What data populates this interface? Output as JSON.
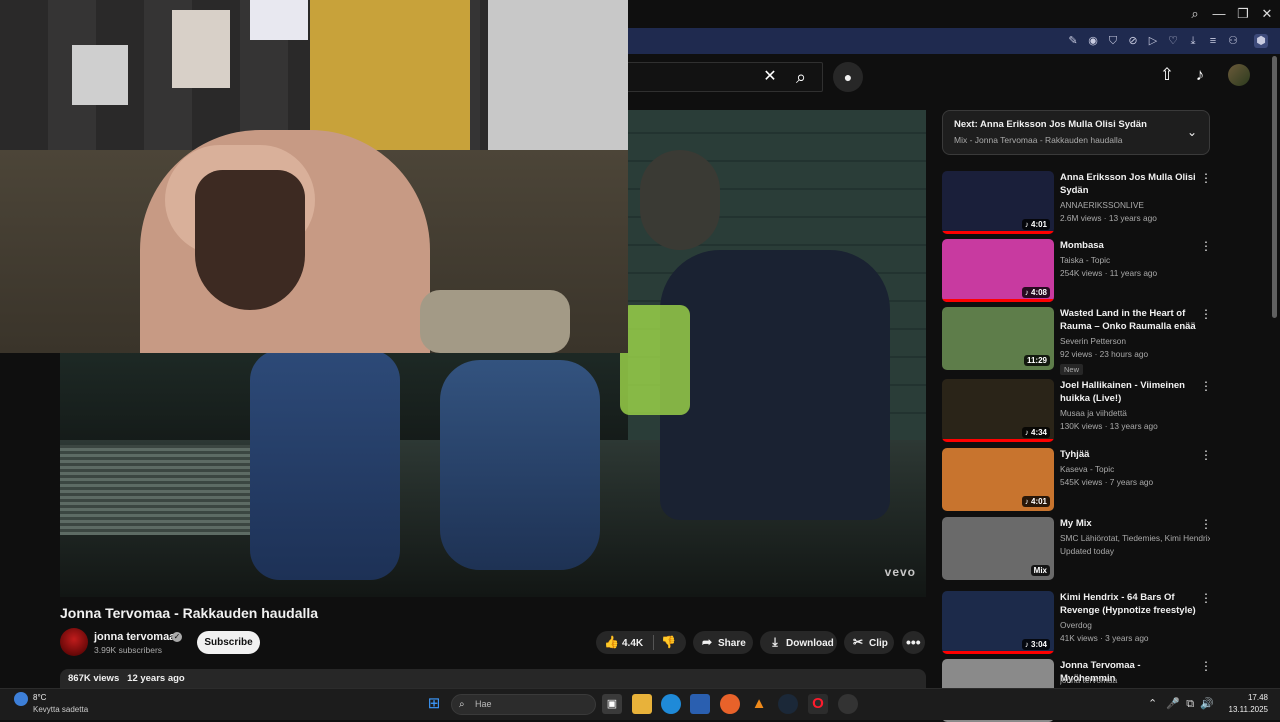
{
  "browser": {
    "window_controls": [
      "search-icon",
      "minimize-icon",
      "restore-icon",
      "close-icon"
    ],
    "extension_icons": [
      "edit-icon",
      "camera-icon",
      "shield-icon",
      "vpn-icon",
      "play-icon",
      "heart-icon",
      "download-icon",
      "menu-icon",
      "profile-icon",
      "extension-icon"
    ]
  },
  "youtube_header": {
    "clear_icon": "✕",
    "search_icon": "⌕",
    "mic_icon": "🎙",
    "upload_icon": "⇧",
    "bell_icon": "🔔"
  },
  "video": {
    "watermark": "vevo",
    "title": "Jonna Tervomaa - Rakkauden haudalla",
    "channel": "jonna tervomaa",
    "subscribers": "3.99K subscribers",
    "subscribe_label": "Subscribe",
    "likes": "4.4K",
    "share_label": "Share",
    "download_label": "Download",
    "clip_label": "Clip",
    "more_label": "•••",
    "views": "867K views",
    "age": "12 years ago"
  },
  "up_next": {
    "title": "Next: Anna Eriksson Jos Mulla Olisi Sydän",
    "subtitle": "Mix - Jonna Tervomaa - Rakkauden haudalla"
  },
  "recommendations": [
    {
      "title": "Anna Eriksson Jos Mulla Olisi Sydän",
      "channel": "ANNAERIKSSONLIVE",
      "meta": "2.6M views · 13 years ago",
      "duration": "♪ 4:01",
      "progress": 1.0,
      "thumb_color": "#1a1f3a"
    },
    {
      "title": "Mombasa",
      "channel": "Taiska - Topic",
      "meta": "254K views · 11 years ago",
      "duration": "♪ 4:08",
      "progress": 1.0,
      "thumb_color": "#c83aa0"
    },
    {
      "title": "Wasted Land in the Heart of Rauma – Onko Raumalla enää ...",
      "channel": "Severin Petterson",
      "meta": "92 views · 23 hours ago",
      "duration": "11:29",
      "badge": "New",
      "progress": 0,
      "thumb_color": "#5e7d4a"
    },
    {
      "title": "Joel Hallikainen - Viimeinen huikka (Live!)",
      "channel": "Musaa ja viihdettä",
      "meta": "130K views · 13 years ago",
      "duration": "♪ 4:34",
      "progress": 1.0,
      "thumb_color": "#2a2418"
    },
    {
      "title": "Tyhjää",
      "channel": "Kaseva - Topic",
      "meta": "545K views · 7 years ago",
      "duration": "♪ 4:01",
      "progress": 0,
      "thumb_color": "#c8742e"
    },
    {
      "title": "My Mix",
      "channel": "SMC Lähiörotat, Tiedemies, Kimi Hendrix...",
      "meta": "Updated today",
      "duration": "Mix",
      "progress": 0,
      "thumb_color": "#6a6a6a"
    },
    {
      "title": "Kimi Hendrix - 64 Bars Of Revenge (Hypnotize freestyle)",
      "channel": "Overdog",
      "meta": "41K views · 3 years ago",
      "duration": "♪ 3:04",
      "progress": 1.0,
      "thumb_color": "#1c2a4a"
    },
    {
      "title": "Jonna Tervomaa - Myöhemmin",
      "channel": "jonna tervomaa",
      "meta": "",
      "duration": "",
      "progress": 0,
      "thumb_color": "#8a8a8a"
    }
  ],
  "taskbar": {
    "weather_temp": "8°C",
    "weather_desc": "Kevytta sadetta",
    "search_placeholder": "Hae",
    "time": "17.48",
    "date": "13.11.2025"
  }
}
